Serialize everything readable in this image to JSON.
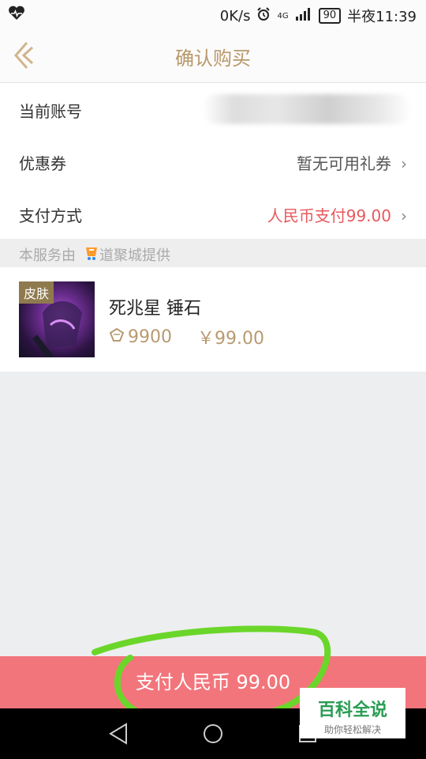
{
  "status_bar": {
    "speed": "0K/s",
    "network": "4G",
    "battery": "90",
    "time": "半夜11:39",
    "icons": [
      "heart-rate-icon",
      "alarm-icon",
      "signal-icon",
      "battery-icon"
    ]
  },
  "header": {
    "title": "确认购买"
  },
  "rows": {
    "account_label": "当前账号",
    "coupon_label": "优惠券",
    "coupon_value": "暂无可用礼券",
    "payment_label": "支付方式",
    "payment_value": "人民币支付99.00"
  },
  "provider": {
    "prefix": "本服务由",
    "suffix": "道聚城提供"
  },
  "product": {
    "tag": "皮肤",
    "name": "死兆星 锤石",
    "coupons": "9900",
    "price": "￥99.00"
  },
  "pay_button": {
    "label": "支付人民币 99.00"
  },
  "watermark": {
    "title": "百科全说",
    "subtitle": "助你轻松解决"
  },
  "colors": {
    "accent": "#b9976a",
    "pay": "#f2757b",
    "price_red": "#e8585d",
    "annotation": "#6bd62a"
  }
}
